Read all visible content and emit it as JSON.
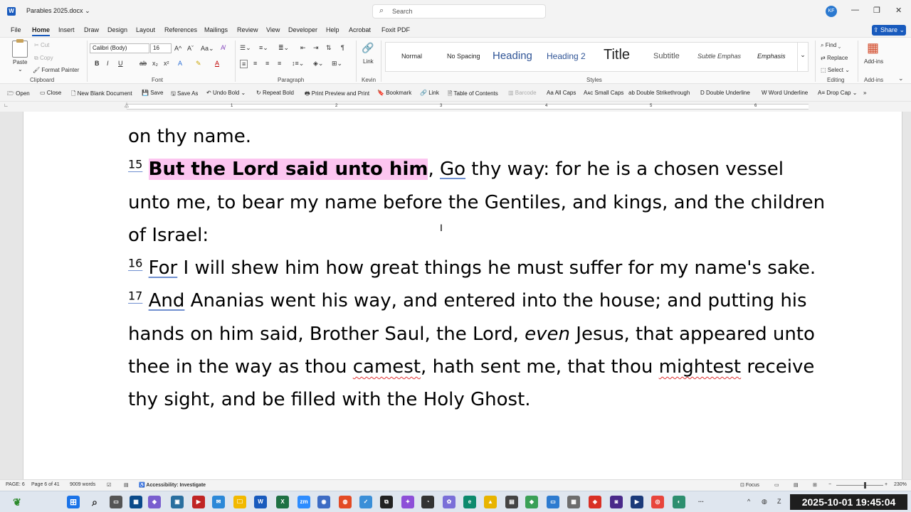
{
  "titlebar": {
    "doc_title": "Parables 2025.docx",
    "search_placeholder": "Search",
    "avatar_initials": "KF",
    "app_icon": "W"
  },
  "menu": {
    "items": [
      "File",
      "Home",
      "Insert",
      "Draw",
      "Design",
      "Layout",
      "References",
      "Mailings",
      "Review",
      "View",
      "Developer",
      "Help",
      "Acrobat",
      "Foxit PDF"
    ],
    "active": "Home",
    "share_label": "Share"
  },
  "ribbon": {
    "clipboard": {
      "paste": "Paste",
      "cut": "Cut",
      "copy": "Copy",
      "format_painter": "Format Painter",
      "label": "Clipboard"
    },
    "font": {
      "name": "Calibri (Body)",
      "size": "16",
      "label": "Font"
    },
    "paragraph": {
      "label": "Paragraph"
    },
    "kevin": {
      "link": "Link",
      "label": "Kevin"
    },
    "styles": {
      "items": [
        "Normal",
        "No Spacing",
        "Heading",
        "Heading 2",
        "Title",
        "Subtitle",
        "Subtle Emphas",
        "Emphasis"
      ],
      "label": "Styles"
    },
    "editing": {
      "find": "Find",
      "replace": "Replace",
      "select": "Select",
      "label": "Editing"
    },
    "addins": {
      "label": "Add-ins",
      "button": "Add-ins"
    }
  },
  "qat": {
    "items": [
      "Open",
      "Close",
      "New Blank Document",
      "Save",
      "Save As",
      "Undo Bold",
      "Repeat Bold",
      "Print Preview and Print",
      "Bookmark",
      "Link",
      "Table of Contents",
      "Barcode",
      "All Caps",
      "Small Caps",
      "Double Strikethrough",
      "Double Underline",
      "Word Underline",
      "Drop Cap"
    ]
  },
  "ruler": {
    "numbers": [
      "1",
      "2",
      "3",
      "4",
      "5",
      "6"
    ]
  },
  "document": {
    "line1": "on thy name.",
    "v15_num": "15",
    "v15_highlight": "But the Lord said unto him",
    "v15_comma": ",",
    "v15_go": "Go",
    "v15_rest": " thy way: for he is a chosen vessel unto me, to bear my name before the Gentiles, and kings, and the children of Israel:",
    "v16_num": "16",
    "v16_for": "For",
    "v16_rest": " I will shew him how great things he must suffer for my name's sake.",
    "v17_num": "17",
    "v17_and": "And",
    "v17_a": " Ananias went his way, and entered into the house; and putting his hands on him said, Brother Saul, the Lord, ",
    "v17_even": "even",
    "v17_b": " Jesus, that appeared unto thee in the way as thou ",
    "v17_camest": "camest",
    "v17_c": ", hath sent me, that thou ",
    "v17_mightest": "mightest",
    "v17_d": " receive thy sight, and be filled with the Holy Ghost."
  },
  "status": {
    "page": "PAGE: 6",
    "page_of": "Page 6 of 41",
    "words": "9009 words",
    "accessibility": "Accessibility: Investigate",
    "focus": "Focus",
    "zoom": "230%"
  },
  "taskbar": {
    "datetime": "2025-10-01 19:45:04"
  }
}
